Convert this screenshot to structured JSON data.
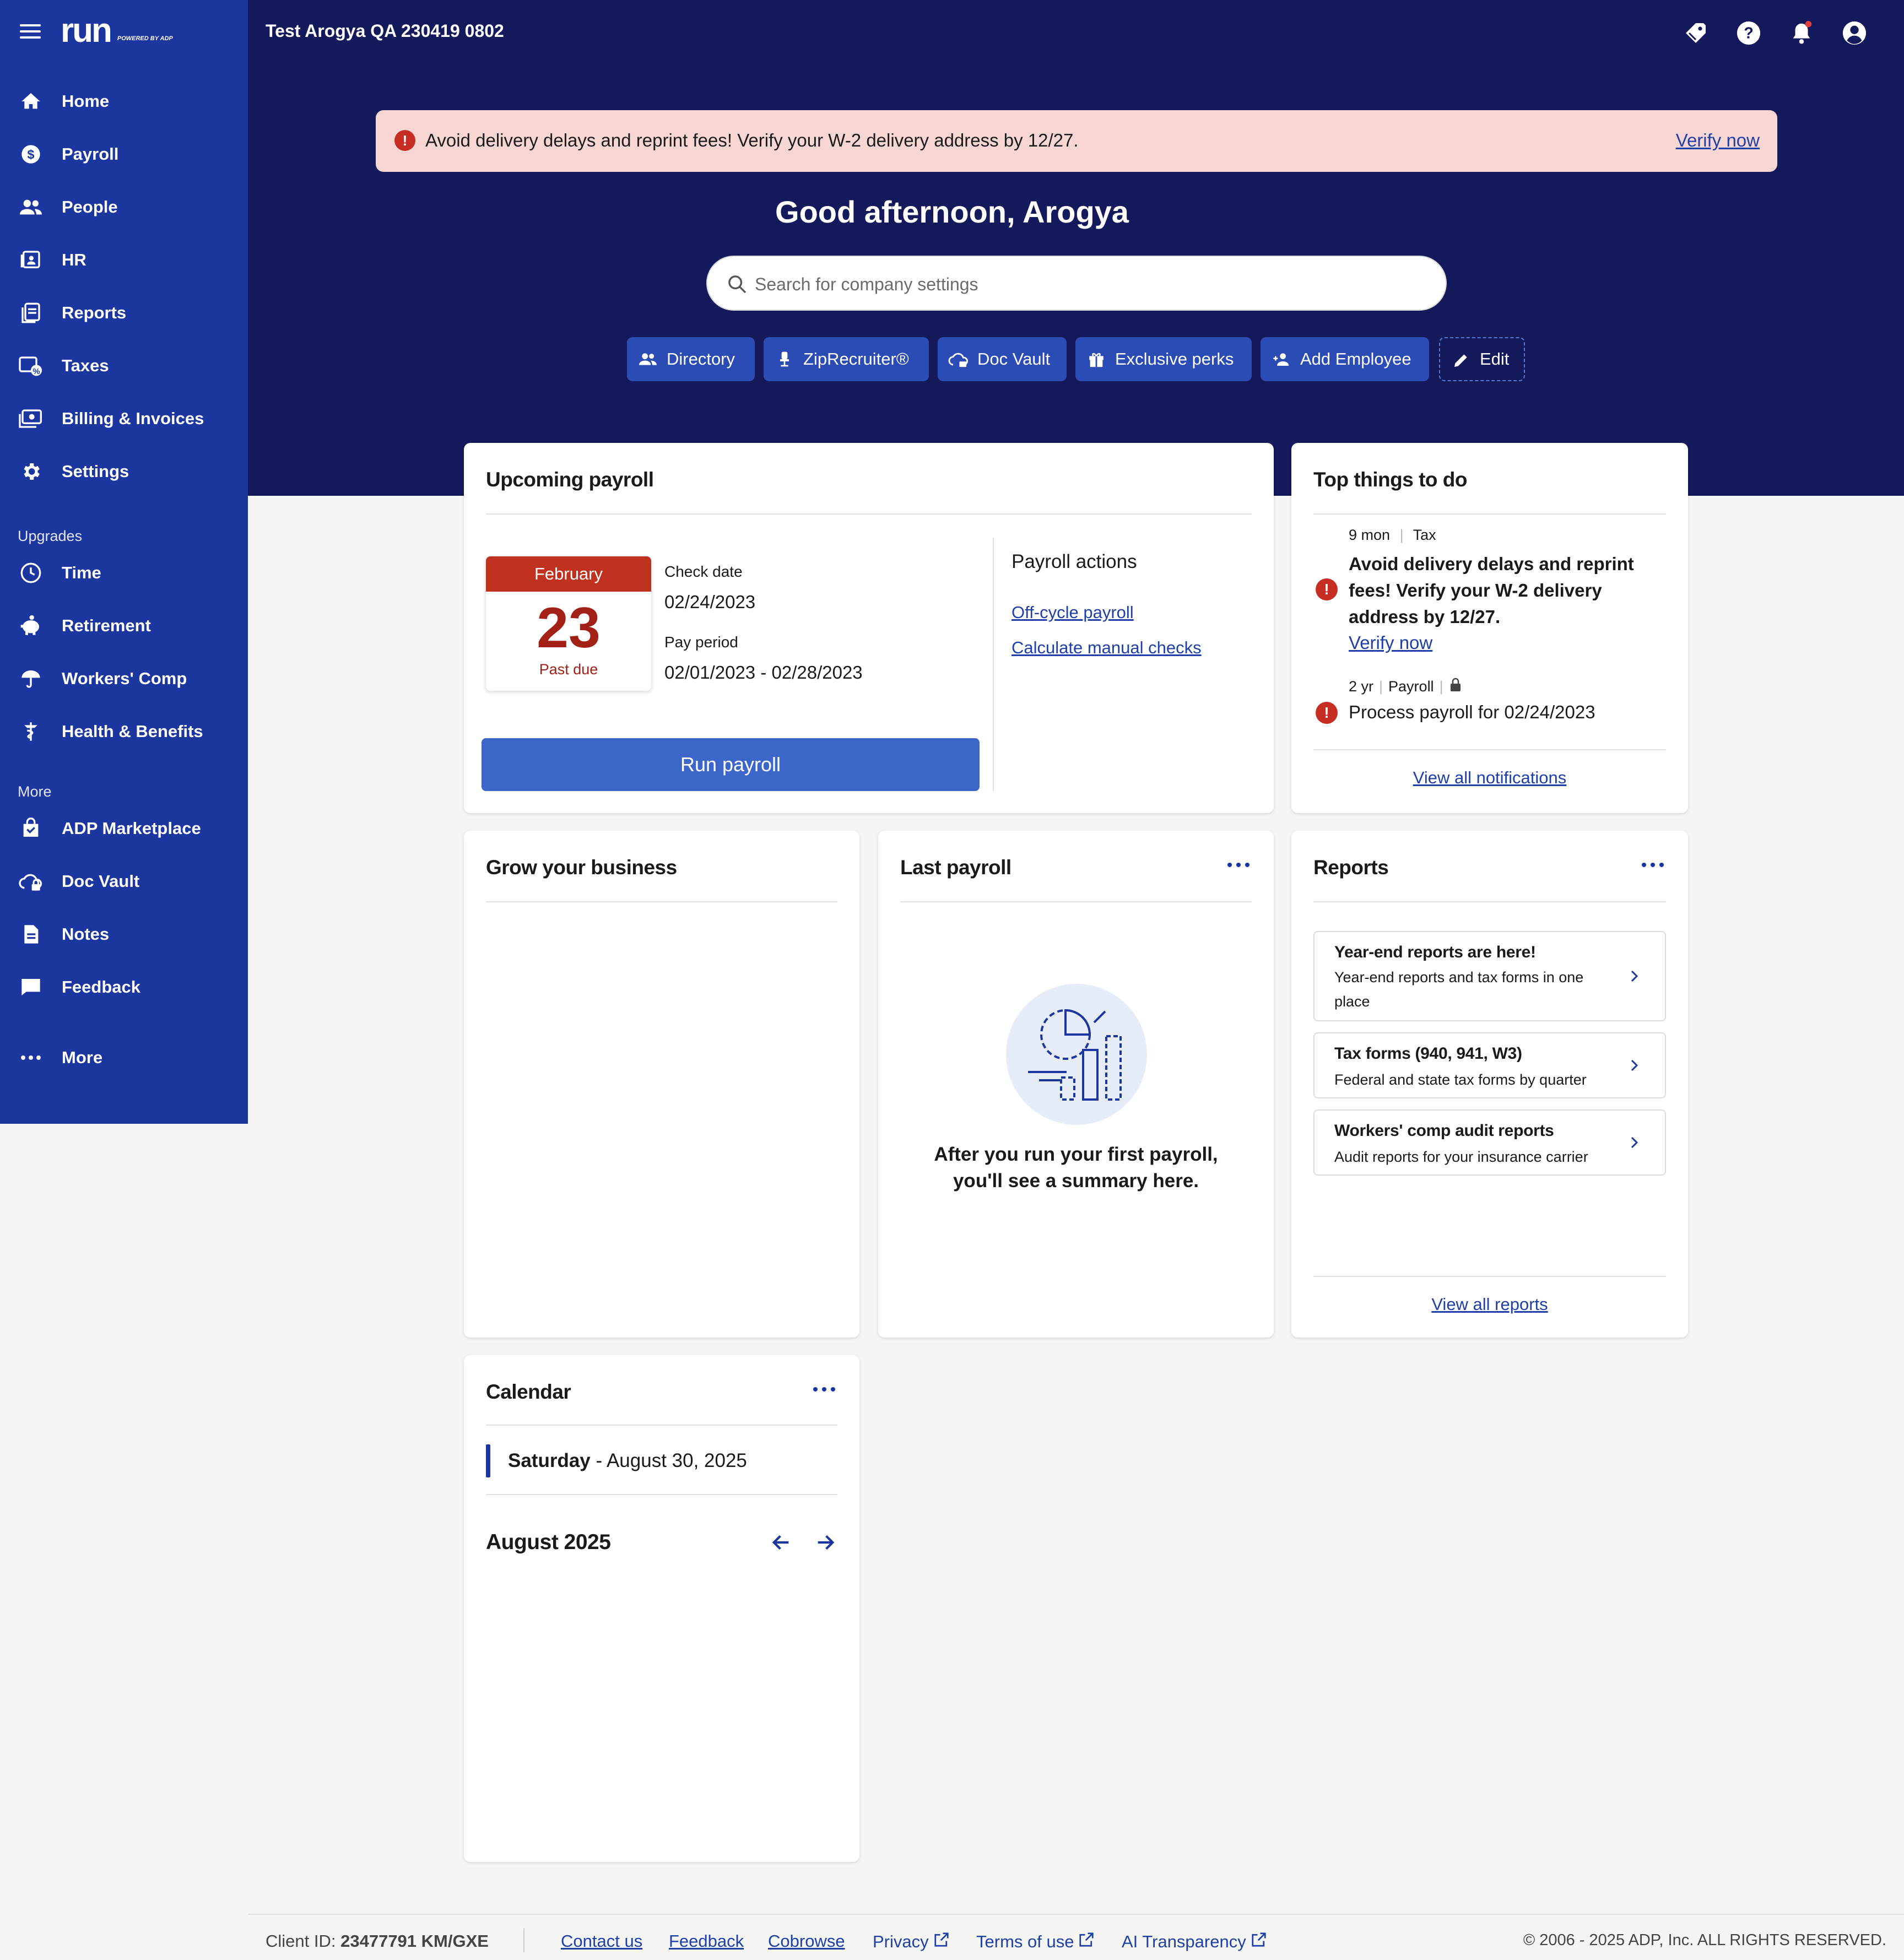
{
  "app": {
    "logo_text": "run",
    "logo_sub": "POWERED BY ADP",
    "company_name": "Test Arogya QA 230419 0802"
  },
  "sidebar": {
    "items": [
      {
        "label": "Home",
        "icon": "home-icon"
      },
      {
        "label": "Payroll",
        "icon": "dollar-icon"
      },
      {
        "label": "People",
        "icon": "people-icon"
      },
      {
        "label": "HR",
        "icon": "id-card-icon"
      },
      {
        "label": "Reports",
        "icon": "reports-icon"
      },
      {
        "label": "Taxes",
        "icon": "taxes-icon"
      },
      {
        "label": "Billing & Invoices",
        "icon": "billing-icon"
      },
      {
        "label": "Settings",
        "icon": "gear-icon"
      }
    ],
    "upgrades_heading": "Upgrades",
    "upgrades": [
      {
        "label": "Time",
        "icon": "clock-icon"
      },
      {
        "label": "Retirement",
        "icon": "piggy-bank-icon"
      },
      {
        "label": "Workers' Comp",
        "icon": "umbrella-icon"
      },
      {
        "label": "Health & Benefits",
        "icon": "caduceus-icon"
      }
    ],
    "more_heading": "More",
    "more": [
      {
        "label": "ADP Marketplace",
        "icon": "bag-icon"
      },
      {
        "label": "Doc Vault",
        "icon": "cloud-lock-icon"
      },
      {
        "label": "Notes",
        "icon": "document-icon"
      },
      {
        "label": "Feedback",
        "icon": "chat-icon"
      }
    ],
    "more_button": "More"
  },
  "alert": {
    "message": "Avoid delivery delays and reprint fees! Verify your W-2 delivery address by 12/27.",
    "link": "Verify now"
  },
  "greeting": "Good afternoon, Arogya",
  "search": {
    "placeholder": "Search for company settings"
  },
  "quick_actions": [
    {
      "label": "Directory",
      "icon": "people-icon"
    },
    {
      "label": "ZipRecruiter®",
      "icon": "chair-icon"
    },
    {
      "label": "Doc Vault",
      "icon": "cloud-lock-icon"
    },
    {
      "label": "Exclusive perks",
      "icon": "gift-icon"
    },
    {
      "label": "Add Employee",
      "icon": "add-person-icon"
    },
    {
      "label": "Edit",
      "icon": "pencil-icon"
    }
  ],
  "upcoming_payroll": {
    "title": "Upcoming payroll",
    "month": "February",
    "day": "23",
    "status": "Past due",
    "check_date_label": "Check date",
    "check_date": "02/24/2023",
    "pay_period_label": "Pay period",
    "pay_period": "02/01/2023 - 02/28/2023",
    "actions_title": "Payroll actions",
    "actions": [
      "Off-cycle payroll",
      "Calculate manual checks"
    ],
    "run_button": "Run payroll"
  },
  "top_todo": {
    "title": "Top things to do",
    "items": [
      {
        "age": "9 mon",
        "category": "Tax",
        "text": "Avoid delivery delays and reprint fees! Verify your W-2 delivery address by 12/27.",
        "link": "Verify now"
      },
      {
        "age": "2 yr",
        "category": "Payroll",
        "text": "Process payroll for 02/24/2023"
      }
    ],
    "view_all": "View all notifications"
  },
  "grow": {
    "title": "Grow your business"
  },
  "last_payroll": {
    "title": "Last payroll",
    "empty_line1": "After you run your first payroll,",
    "empty_line2": "you'll see a summary here."
  },
  "reports": {
    "title": "Reports",
    "items": [
      {
        "title": "Year-end reports are here!",
        "desc_line1": "Year-end reports and tax forms in one",
        "desc_line2": "place"
      },
      {
        "title": "Tax forms (940, 941, W3)",
        "desc_line1": "Federal and state tax forms by quarter"
      },
      {
        "title": "Workers' comp audit reports",
        "desc_line1": "Audit reports for your insurance carrier"
      }
    ],
    "view_all": "View all reports"
  },
  "calendar": {
    "title": "Calendar",
    "today_weekday": "Saturday",
    "today_date": " - August 30, 2025",
    "month_label": "August 2025"
  },
  "footer": {
    "client_id_label": "Client ID: ",
    "client_id": "23477791 KM/GXE",
    "links": [
      "Contact us",
      "Feedback",
      "Cobrowse",
      "Privacy",
      "Terms of use",
      "AI Transparency"
    ],
    "copyright": "© 2006 - 2025 ADP, Inc. ALL RIGHTS RESERVED."
  },
  "colors": {
    "sidebar": "#1c36a0",
    "header": "#13195a",
    "alert_bg": "#f8d6d4",
    "accent_button": "#3c66c9",
    "danger": "#c62e23",
    "notification_dot": "#e23b3b"
  }
}
